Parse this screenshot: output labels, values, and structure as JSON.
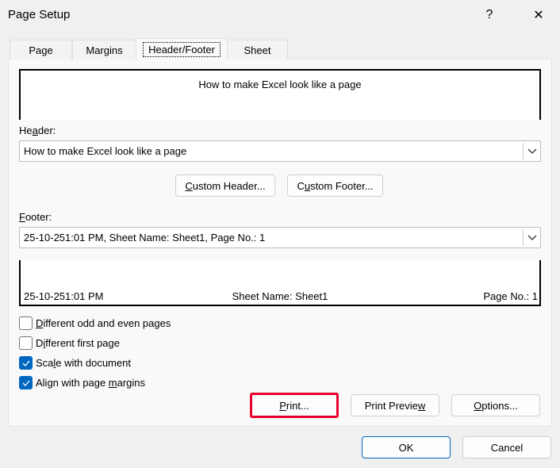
{
  "window": {
    "title": "Page Setup",
    "help": "?",
    "close": "✕"
  },
  "tabs": [
    {
      "label": "Page"
    },
    {
      "label": "Margins"
    },
    {
      "label": "Header/Footer"
    },
    {
      "label": "Sheet"
    }
  ],
  "header_preview": {
    "center": "How to make Excel look like a page"
  },
  "header": {
    "label": [
      "He",
      "a",
      "der:"
    ],
    "value": "How to make Excel look like a page"
  },
  "custom_header": [
    "",
    "C",
    "ustom Header..."
  ],
  "custom_footer": [
    "C",
    "u",
    "stom Footer..."
  ],
  "footer": {
    "label": [
      "",
      "F",
      "ooter:"
    ],
    "value": "25-10-251:01 PM, Sheet Name: Sheet1, Page No.: 1"
  },
  "footer_preview": {
    "left": "25-10-251:01 PM",
    "center": "Sheet Name: Sheet1",
    "right": "Page No.: 1"
  },
  "checkboxes": [
    {
      "label": [
        "",
        "D",
        "ifferent odd and even pages"
      ],
      "checked": false
    },
    {
      "label": [
        "D",
        "i",
        "fferent first page"
      ],
      "checked": false
    },
    {
      "label": [
        "Sca",
        "l",
        "e with document"
      ],
      "checked": true
    },
    {
      "label": [
        "Align with page ",
        "m",
        "argins"
      ],
      "checked": true
    }
  ],
  "buttons": {
    "print": [
      "",
      "P",
      "rint..."
    ],
    "print_preview": [
      "Print Previe",
      "w",
      ""
    ],
    "options": [
      "",
      "O",
      "ptions..."
    ],
    "ok": "OK",
    "cancel": "Cancel"
  },
  "colors": {
    "accent": "#0067c0",
    "highlight": "#e8002a"
  }
}
